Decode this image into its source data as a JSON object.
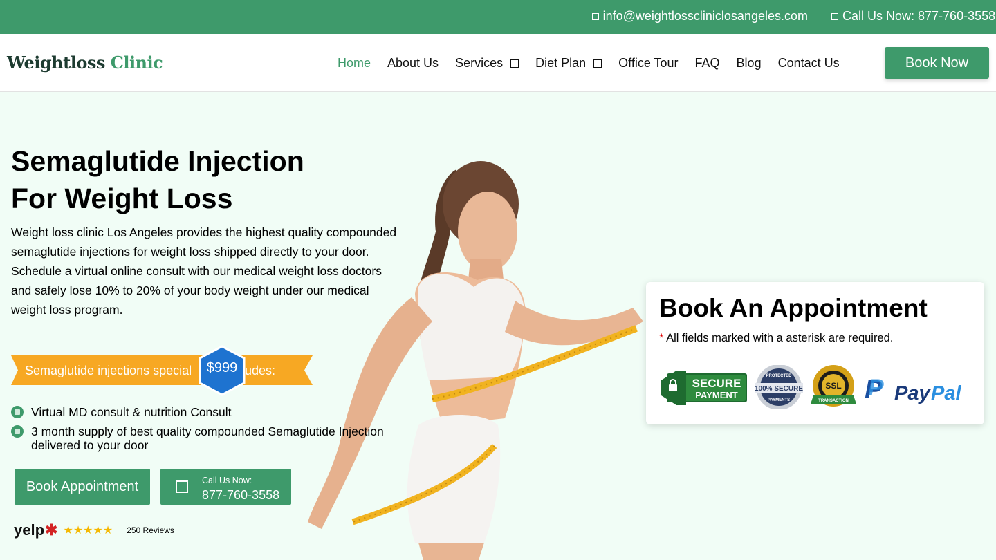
{
  "topbar": {
    "email": "info@weightlossclinicl​osangeles.com",
    "phone": "Call Us Now: 877-760-3558"
  },
  "header": {
    "logo_part1": "Weightloss",
    "logo_part2": "Clinic",
    "nav": [
      {
        "label": "Home",
        "active": true,
        "dropdown": false
      },
      {
        "label": "About Us",
        "dropdown": false
      },
      {
        "label": "Services",
        "dropdown": true
      },
      {
        "label": "Diet Plan",
        "dropdown": true
      },
      {
        "label": "Office Tour",
        "dropdown": false
      },
      {
        "label": "FAQ",
        "dropdown": false
      },
      {
        "label": "Blog",
        "dropdown": false
      },
      {
        "label": "Contact Us",
        "dropdown": false
      }
    ],
    "book_now": "Book Now"
  },
  "hero": {
    "title_line1": "Semaglutide Injection",
    "title_line2": "For Weight Loss",
    "desc1": "Weight loss clinic Los Angeles provides the highest quality compounded semaglutide injections for weight loss shipped directly to your door.",
    "desc2": "Schedule a virtual online consult with our medical weight loss doctors and safely lose 10% to 20% of your body weight under our medical weight loss program.",
    "ribbon_text": "Semaglutide injections special",
    "ribbon_suffix": "udes:",
    "price": "$999",
    "features": [
      "Virtual MD consult & nutrition Consult",
      "3 month supply of best quality compounded Semaglutide Injection delivered to your door"
    ],
    "btn_appointment": "Book Appointment",
    "call_label": "Call Us Now:",
    "call_number": "877-760-3558",
    "yelp_logo": "yelp",
    "stars": "★★★★★",
    "reviews": "250 Reviews"
  },
  "card": {
    "title": "Book An Appointment",
    "asterisk": "*",
    "required_note": "All fields marked with a asterisk are required.",
    "badge_secure_1": "SECURE",
    "badge_secure_2": "PAYMENT",
    "badge_100_1": "PROTECTED",
    "badge_100_2": "100% SECURE",
    "badge_100_3": "PAYMENTS",
    "badge_ssl_1": "SSL",
    "badge_ssl_2": "TRANSACTION",
    "paypal_1": "Pay",
    "paypal_2": "Pal"
  },
  "colors": {
    "brand_green": "#3e9a6b",
    "ribbon_orange": "#f7a823",
    "price_blue": "#1e73d0",
    "hero_bg": "#f1fdf6"
  }
}
